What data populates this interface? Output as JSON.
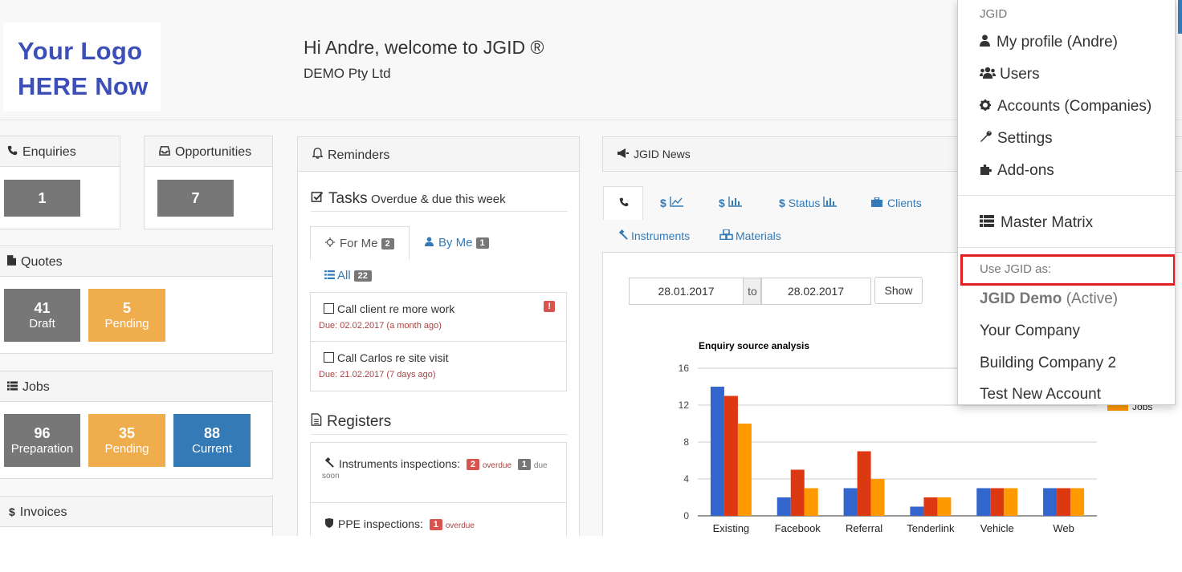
{
  "header": {
    "logo_line1": "Your Logo",
    "logo_line2": "HERE Now",
    "welcome": "Hi Andre, welcome to JGID ®",
    "company": "DEMO Pty Ltd"
  },
  "enquiries": {
    "title": "Enquiries",
    "count": "1"
  },
  "opportunities": {
    "title": "Opportunities",
    "count": "7"
  },
  "quotes": {
    "title": "Quotes",
    "draft_num": "41",
    "draft_label": "Draft",
    "pending_num": "5",
    "pending_label": "Pending"
  },
  "jobs": {
    "title": "Jobs",
    "prep_num": "96",
    "prep_label": "Preparation",
    "pending_num": "35",
    "pending_label": "Pending",
    "current_num": "88",
    "current_label": "Current"
  },
  "invoices": {
    "title": "Invoices"
  },
  "reminders": {
    "title": "Reminders",
    "tasks_title": "Tasks",
    "tasks_sub": "Overdue & due this week",
    "tab_forme": "For Me",
    "tab_forme_count": "2",
    "tab_byme": "By Me",
    "tab_byme_count": "1",
    "tab_all": "All",
    "tab_all_count": "22",
    "task1": "Call client re more work",
    "task1_due": "Due: 02.02.2017 (a month ago)",
    "task1_flag": "!",
    "task2": "Call Carlos re site visit",
    "task2_due": "Due: 21.02.2017 (7 days ago)",
    "registers_title": "Registers",
    "reg1": "Instruments inspections:",
    "reg1_overdue_count": "2",
    "reg1_overdue": "overdue",
    "reg1_due_count": "1",
    "reg1_due": "due",
    "reg1_soon": "soon",
    "reg2": "PPE inspections:",
    "reg2_overdue_count": "1",
    "reg2_overdue": "overdue"
  },
  "news": {
    "title": "JGID News",
    "tab_status": "Status",
    "tab_clients": "Clients",
    "tab_instruments": "Instruments",
    "tab_materials": "Materials",
    "dollar1": "$",
    "dollar2": "$",
    "dollar3": "$",
    "date_from": "28.01.2017",
    "date_to_label": "to",
    "date_to": "28.02.2017",
    "show_button": "Show"
  },
  "menu": {
    "heading": "JGID",
    "profile": "My profile (Andre)",
    "users": "Users",
    "accounts": "Accounts (Companies)",
    "settings": "Settings",
    "addons": "Add-ons",
    "matrix": "Master Matrix",
    "use_as": "Use JGID as:",
    "demo": "JGID Demo",
    "demo_state": "(Active)",
    "your_company": "Your Company",
    "building": "Building Company 2",
    "test": "Test New Account"
  },
  "colors": {
    "brand_blue": "#337ab7",
    "tile_gray": "#777777",
    "tile_orange": "#f0ad4e",
    "alert_red": "#d9534f",
    "highlight_red": "#e02020"
  },
  "chart_data": {
    "type": "bar",
    "title": "Enquiry source analysis",
    "categories": [
      "Existing",
      "Facebook",
      "Referral",
      "Tenderlink",
      "Vehicle",
      "Web"
    ],
    "ylim": [
      0,
      16
    ],
    "yticks": [
      0,
      4,
      8,
      12,
      16
    ],
    "grid": true,
    "legend_position": "right",
    "series": [
      {
        "values": [
          14,
          2,
          3,
          1,
          3,
          3
        ],
        "color": "#3366cc"
      },
      {
        "values": [
          13,
          5,
          7,
          2,
          3,
          3
        ],
        "color": "#dc3912"
      },
      {
        "name": "Jobs",
        "values": [
          10,
          3,
          4,
          2,
          3,
          3
        ],
        "color": "#ff9900"
      }
    ]
  }
}
